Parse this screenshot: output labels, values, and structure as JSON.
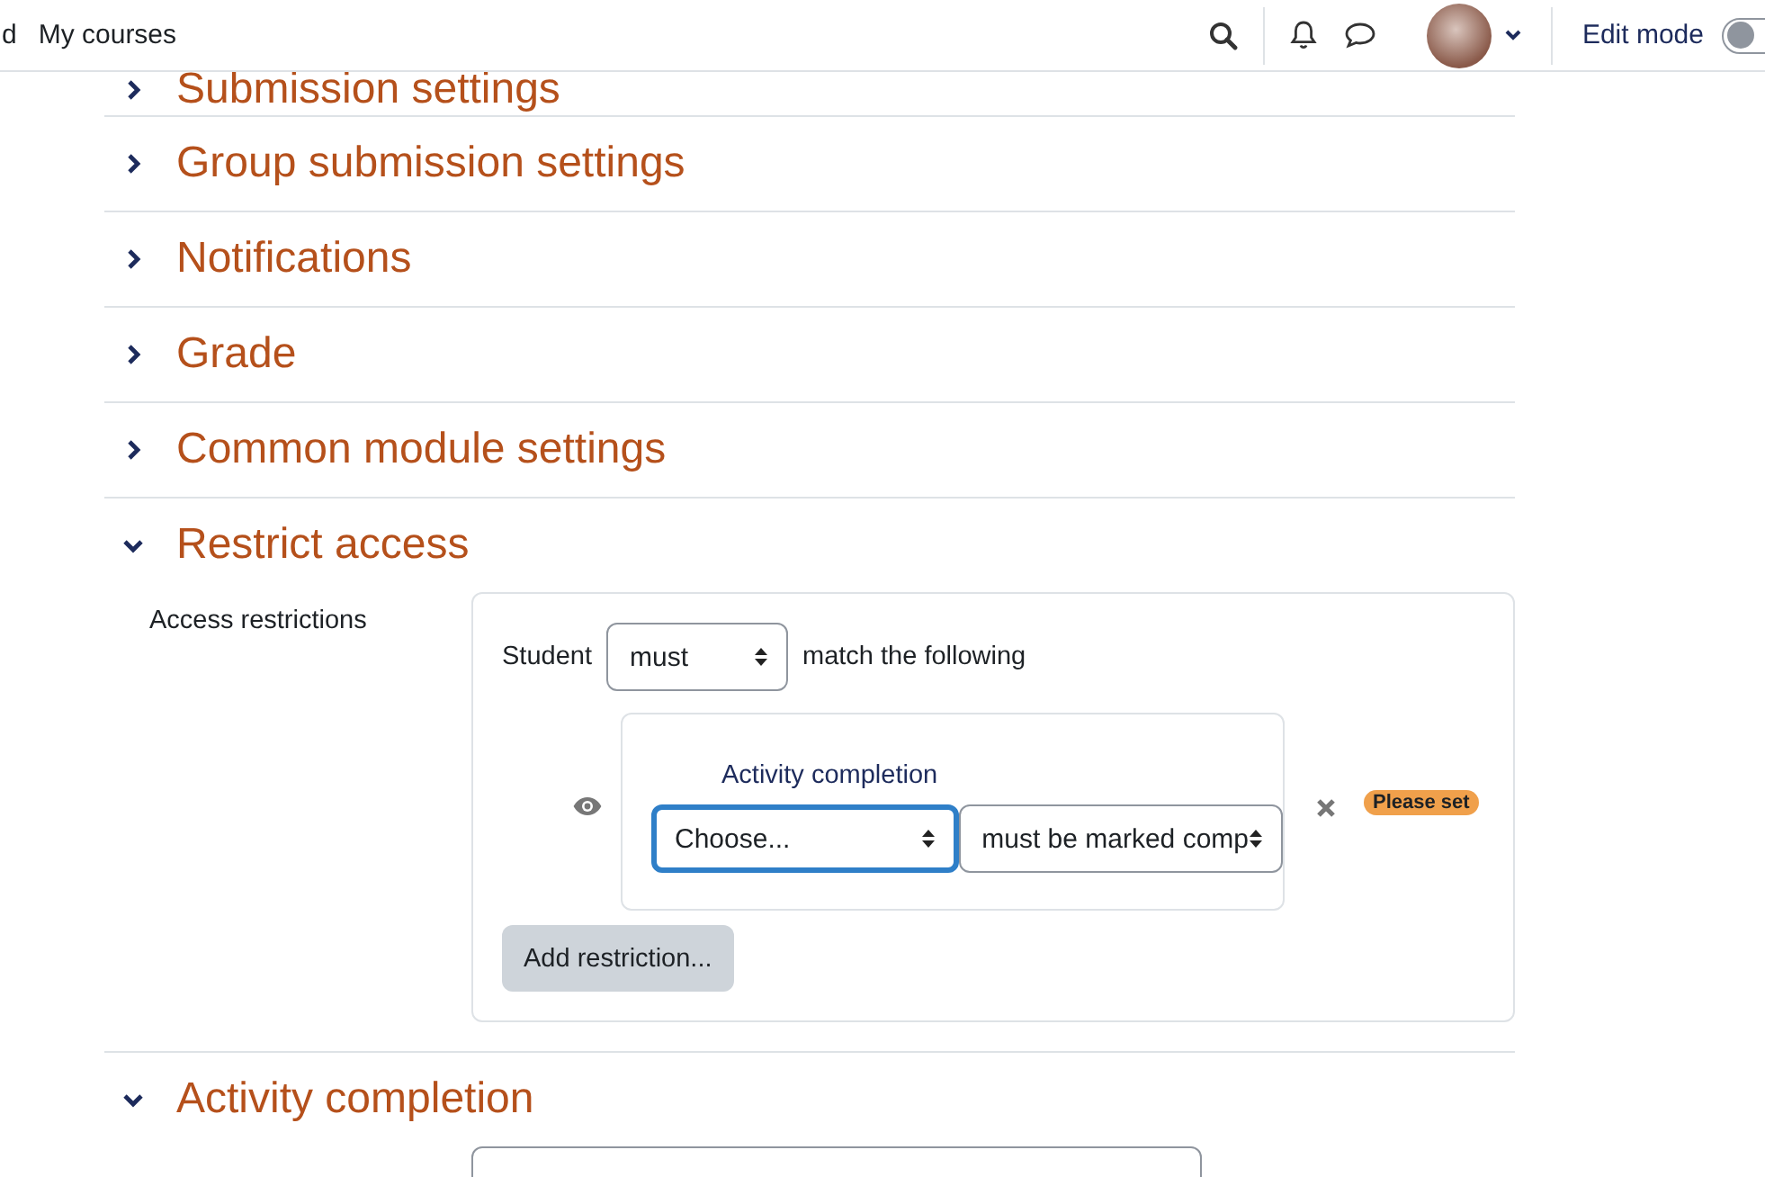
{
  "navbar": {
    "cut_text": "d",
    "links": [
      "My courses"
    ],
    "edit_mode": {
      "label": "Edit mode",
      "on": false
    }
  },
  "sections": [
    {
      "title": "Submission settings",
      "expanded": false
    },
    {
      "title": "Group submission settings",
      "expanded": false
    },
    {
      "title": "Notifications",
      "expanded": false
    },
    {
      "title": "Grade",
      "expanded": false
    },
    {
      "title": "Common module settings",
      "expanded": false
    },
    {
      "title": "Restrict access",
      "expanded": true,
      "kind": "restrictions",
      "field_label": "Access restrictions",
      "restrictions": {
        "prefix": "Student",
        "match_select": "must",
        "suffix": "match the following",
        "conditions": [
          {
            "title": "Activity completion",
            "visible": true,
            "activity_select": "Choose...",
            "activity_focused": true,
            "state_select": "must be marked comp",
            "badge": "Please set"
          }
        ],
        "add_button": "Add restriction..."
      }
    },
    {
      "title": "Activity completion",
      "expanded": true,
      "kind": "field_stub"
    }
  ]
}
